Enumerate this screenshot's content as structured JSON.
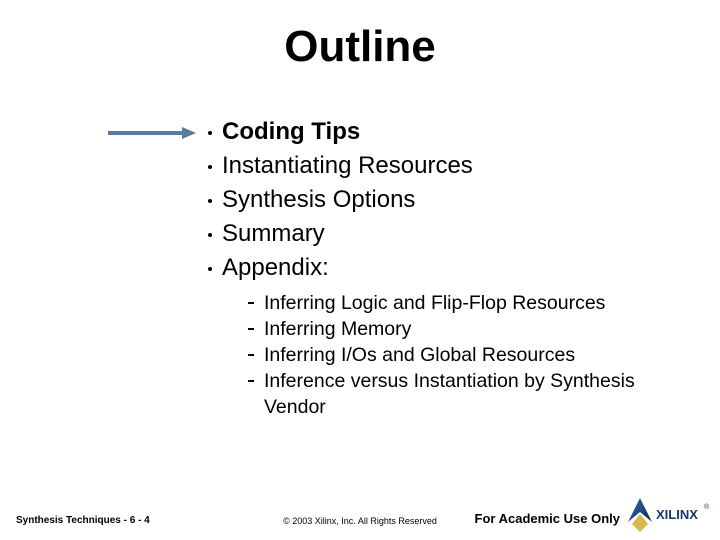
{
  "title": "Outline",
  "arrow_color": "#5B7AA0",
  "bullets": [
    {
      "text": "Coding Tips",
      "emph": true
    },
    {
      "text": "Instantiating Resources",
      "emph": false
    },
    {
      "text": "Synthesis Options",
      "emph": false
    },
    {
      "text": "Summary",
      "emph": false
    },
    {
      "text": "Appendix:",
      "emph": false
    }
  ],
  "sub_bullets": [
    "Inferring Logic and  Flip-Flop Resources",
    "Inferring Memory",
    "Inferring I/Os and Global Resources",
    "Inference versus Instantiation by Synthesis Vendor"
  ],
  "footer": {
    "left": "Synthesis Techniques  -  6  - 4",
    "mid": "© 2003 Xilinx, Inc. All Rights Reserved",
    "right": "For Academic Use Only"
  },
  "logo_name": "XILINX"
}
